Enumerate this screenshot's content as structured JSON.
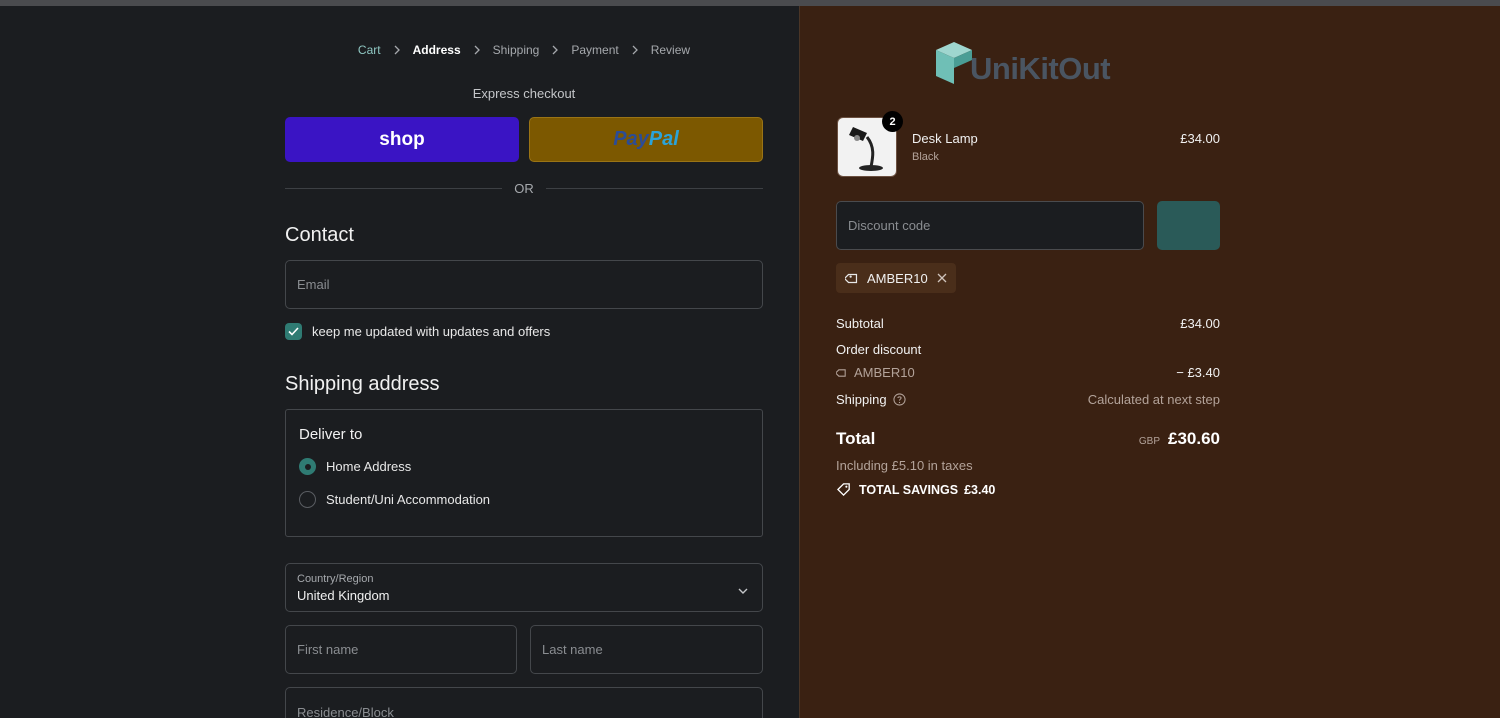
{
  "breadcrumb": {
    "items": [
      {
        "label": "Cart",
        "state": "link"
      },
      {
        "label": "Address",
        "state": "active"
      },
      {
        "label": "Shipping",
        "state": "inactive"
      },
      {
        "label": "Payment",
        "state": "inactive"
      },
      {
        "label": "Review",
        "state": "inactive"
      }
    ]
  },
  "express": {
    "title": "Express checkout",
    "shop_label": "shop",
    "paypal_part1": "Pay",
    "paypal_part2": "Pal",
    "or_label": "OR"
  },
  "contact": {
    "heading": "Contact",
    "email_placeholder": "Email",
    "newsletter_label": "keep me updated with updates and offers",
    "newsletter_checked": true
  },
  "shipping": {
    "heading": "Shipping address",
    "deliver_to": "Deliver to",
    "options": [
      {
        "label": "Home Address",
        "selected": true
      },
      {
        "label": "Student/Uni Accommodation",
        "selected": false
      }
    ],
    "country_label": "Country/Region",
    "country_value": "United Kingdom",
    "first_name_placeholder": "First name",
    "last_name_placeholder": "Last name",
    "residence_placeholder": "Residence/Block"
  },
  "summary": {
    "brand": "UniKitOut",
    "item": {
      "name": "Desk Lamp",
      "variant": "Black",
      "quantity": "2",
      "price": "£34.00"
    },
    "discount_placeholder": "Discount code",
    "applied_code": "AMBER10",
    "subtotal_label": "Subtotal",
    "subtotal_value": "£34.00",
    "order_discount_label": "Order discount",
    "discount_code": "AMBER10",
    "discount_value": "− £3.40",
    "shipping_label": "Shipping",
    "shipping_value": "Calculated at next step",
    "total_label": "Total",
    "total_currency": "GBP",
    "total_value": "£30.60",
    "taxes_note": "Including £5.10 in taxes",
    "savings_label": "TOTAL SAVINGS",
    "savings_value": "£3.40"
  },
  "colors": {
    "accent": "#2f7b73",
    "left_bg": "#1b1d20",
    "right_bg": "#3a2112",
    "shop_blue": "#3a14c4",
    "paypal_gold": "#7c5800"
  }
}
